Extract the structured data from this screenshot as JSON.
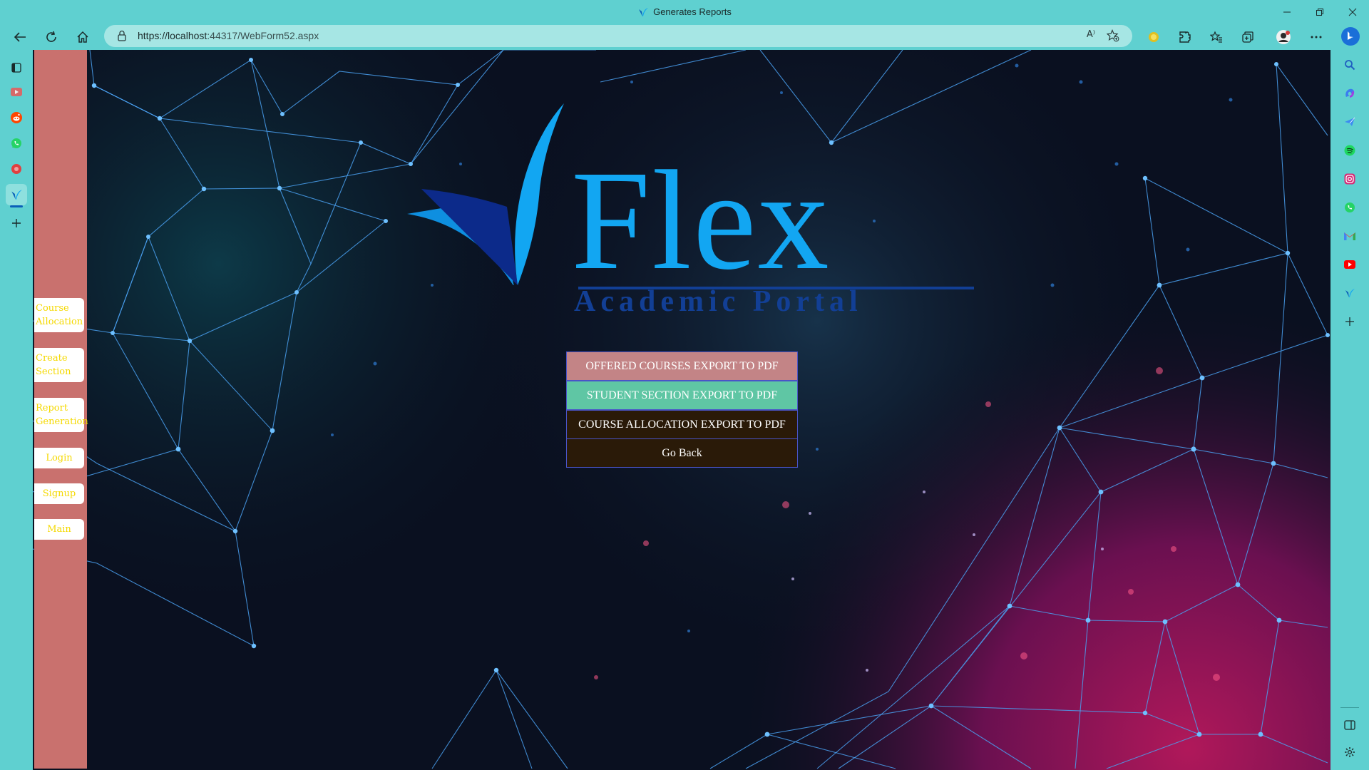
{
  "window": {
    "title": "Generates Reports",
    "controls": [
      "minimize",
      "restore",
      "close"
    ]
  },
  "address_bar": {
    "url_host": "https://localhost",
    "url_port_path": ":44317/WebForm52.aspx",
    "read_aloud_label": "A⁾"
  },
  "nav": {
    "back_icon": "back-arrow-icon",
    "refresh_icon": "refresh-icon",
    "home_icon": "home-icon"
  },
  "left_tabs": [
    "workspaces",
    "tab-youtube",
    "tab-reddit",
    "tab-whatsapp",
    "tab-recording",
    "tab-flex",
    "new-tab"
  ],
  "right_sidebar": [
    "search",
    "copilot",
    "paper-plane",
    "spotify",
    "instagram",
    "whatsapp",
    "gmail",
    "youtube",
    "flex",
    "add"
  ],
  "page": {
    "logo": {
      "title": "Flex",
      "subtitle": "Academic Portal",
      "colors": {
        "title": "#12a6f2",
        "subtitle": "#123f95"
      }
    },
    "side_menu": {
      "course_allocation": "Course Allocation",
      "create_section": "Create Section",
      "report_generation": "Report Generation",
      "login": "Login",
      "signup": "Signup",
      "main": "Main"
    },
    "buttons": {
      "offered_courses": "OFFERED COURSES EXPORT TO PDF",
      "student_section": "STUDENT SECTION EXPORT TO PDF",
      "course_allocation": "COURSE ALLOCATION EXPORT TO PDF",
      "go_back": "Go Back"
    },
    "colors": {
      "side_panel": "#c9716e",
      "side_button_text": "#f5d900",
      "offered_btn": "#c38486",
      "student_btn": "#5fc6a4",
      "dark_btn": "#2a1a08"
    }
  }
}
